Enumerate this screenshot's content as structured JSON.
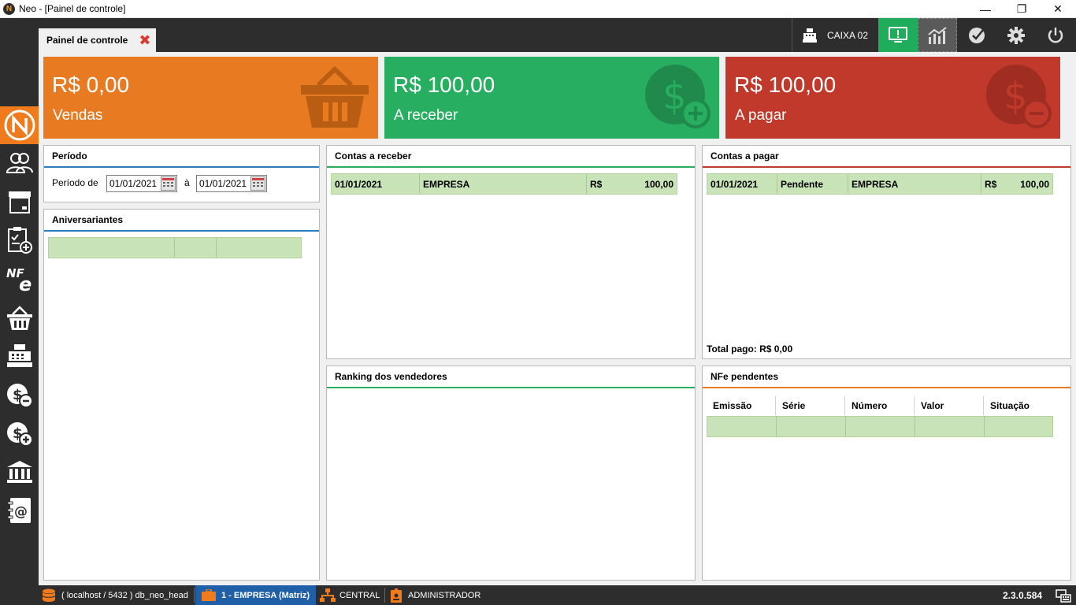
{
  "window": {
    "title": "Neo - [Painel de controle]",
    "minimize": "—",
    "maximize": "❐",
    "close": "✕"
  },
  "tab": {
    "label": "Painel de controle",
    "close": "✖"
  },
  "caixa": {
    "label": "CAIXA 02"
  },
  "cards": {
    "vendas": {
      "value": "R$ 0,00",
      "label": "Vendas",
      "color": "#e87a22"
    },
    "receber": {
      "value": "R$ 100,00",
      "label": "A receber",
      "color": "#27ae60"
    },
    "pagar": {
      "value": "R$ 100,00",
      "label": "A pagar",
      "color": "#c0392b"
    }
  },
  "periodo": {
    "title": "Período",
    "from_label": "Período de",
    "from": "01/01/2021",
    "to_label": "à",
    "to": "01/01/2021"
  },
  "aniversariantes": {
    "title": "Aniversariantes"
  },
  "contas_receber": {
    "title": "Contas a receber",
    "rows": [
      {
        "date": "01/01/2021",
        "name": "EMPRESA",
        "currency": "R$",
        "value": "100,00"
      }
    ]
  },
  "contas_pagar": {
    "title": "Contas a pagar",
    "rows": [
      {
        "date": "01/01/2021",
        "status": "Pendente",
        "name": "EMPRESA",
        "currency": "R$",
        "value": "100,00"
      }
    ],
    "total": "Total pago: R$ 0,00"
  },
  "ranking": {
    "title": "Ranking dos vendedores"
  },
  "nfe": {
    "title": "NFe pendentes",
    "columns": [
      "Emissão",
      "Série",
      "Número",
      "Valor",
      "Situação"
    ]
  },
  "status": {
    "db": "( localhost / 5432 ) db_neo_head",
    "empresa": "1 - EMPRESA (Matriz)",
    "central": "CENTRAL",
    "user": "ADMINISTRADOR",
    "version": "2.3.0.584"
  },
  "icons": [
    "database-icon",
    "briefcase-icon",
    "network-icon",
    "user-badge-icon",
    "monitor-alert-icon",
    "chart-icon",
    "checkmark-icon",
    "gear-icon",
    "power-icon"
  ]
}
